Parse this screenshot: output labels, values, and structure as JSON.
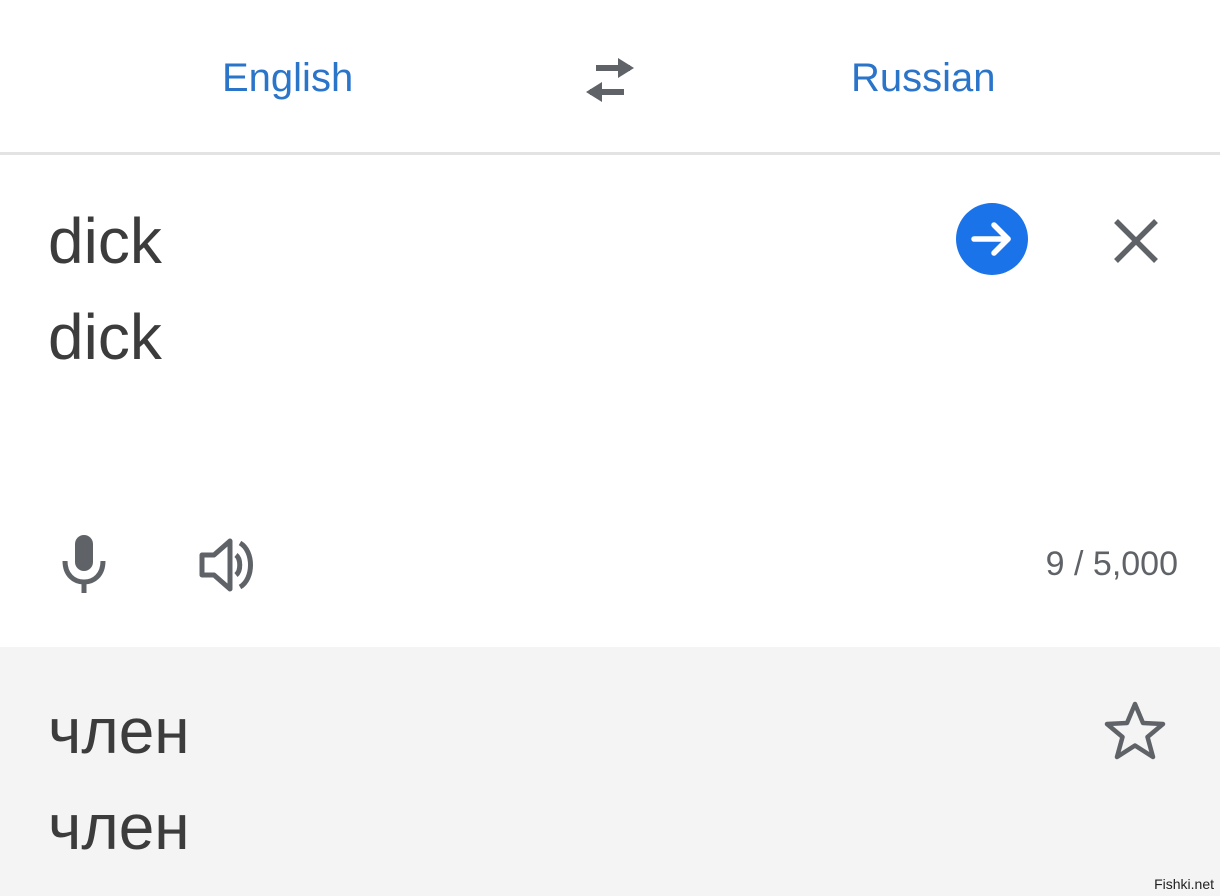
{
  "language_bar": {
    "source_language": "English",
    "target_language": "Russian",
    "swap_icon": "swap-arrows-icon"
  },
  "input": {
    "text": "dick\ndick",
    "char_count": "9 / 5,000",
    "go_icon": "arrow-right-icon",
    "clear_icon": "close-icon",
    "mic_icon": "microphone-icon",
    "speak_icon": "speaker-icon"
  },
  "output": {
    "text": "член\nчлен",
    "star_icon": "star-outline-icon"
  },
  "watermark": "Fishki.net",
  "colors": {
    "accent": "#1a73e8",
    "language_text": "#2a74c9",
    "body_text": "#3c3c3c",
    "icon": "#5f6368",
    "output_background": "#f4f4f4"
  }
}
